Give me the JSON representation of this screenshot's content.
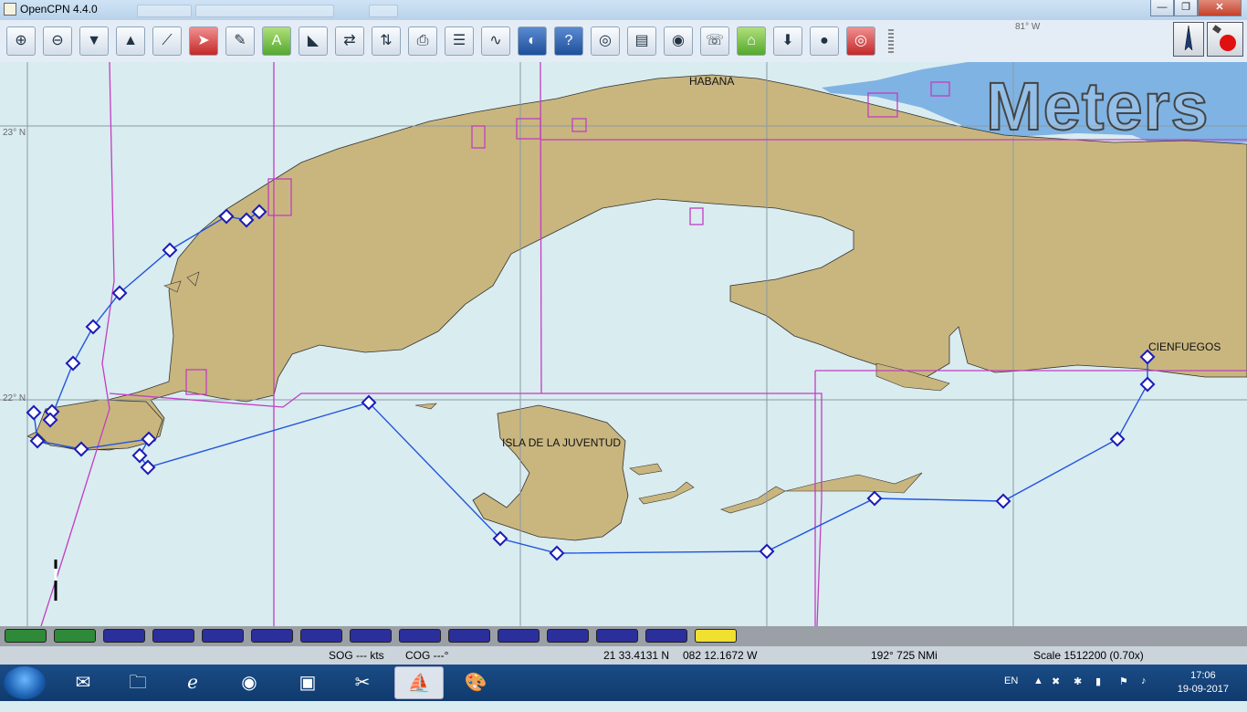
{
  "window": {
    "title": "OpenCPN 4.4.0",
    "minimize": "—",
    "maximize": "❐",
    "close": "✕"
  },
  "toolbar": {
    "tools": [
      {
        "name": "zoom-in-button",
        "glyph": "⊕",
        "style": ""
      },
      {
        "name": "zoom-out-button",
        "glyph": "⊖",
        "style": ""
      },
      {
        "name": "scale-in-button",
        "glyph": "▼",
        "style": ""
      },
      {
        "name": "scale-out-button",
        "glyph": "▲",
        "style": ""
      },
      {
        "name": "route-button",
        "glyph": "⟋",
        "style": ""
      },
      {
        "name": "auto-follow-button",
        "glyph": "➤",
        "style": "red"
      },
      {
        "name": "options-button",
        "glyph": "✎",
        "style": ""
      },
      {
        "name": "text-button",
        "glyph": "A",
        "style": "green"
      },
      {
        "name": "current-tide-button",
        "glyph": "◣",
        "style": ""
      },
      {
        "name": "tide-button",
        "glyph": "⇄",
        "style": ""
      },
      {
        "name": "current-button",
        "glyph": "⇅",
        "style": ""
      },
      {
        "name": "print-button",
        "glyph": "⎙",
        "style": ""
      },
      {
        "name": "route-manager-button",
        "glyph": "☰",
        "style": ""
      },
      {
        "name": "track-button",
        "glyph": "∿",
        "style": ""
      },
      {
        "name": "color-scheme-button",
        "glyph": "◐",
        "style": "navy"
      },
      {
        "name": "help-button",
        "glyph": "?",
        "style": "navy"
      },
      {
        "name": "dashboard-button",
        "glyph": "◎",
        "style": ""
      },
      {
        "name": "grib-button",
        "glyph": "▤",
        "style": ""
      },
      {
        "name": "google-earth-button",
        "glyph": "◉",
        "style": ""
      },
      {
        "name": "chart-download-button",
        "glyph": "☏",
        "style": ""
      },
      {
        "name": "lighthouse-button",
        "glyph": "⌂",
        "style": "green"
      },
      {
        "name": "download-button",
        "glyph": "⬇",
        "style": ""
      },
      {
        "name": "globe-button",
        "glyph": "●",
        "style": ""
      },
      {
        "name": "mob-button",
        "glyph": "◎",
        "style": "red"
      }
    ]
  },
  "map": {
    "units_watermark": "Meters",
    "labels": {
      "habana": "HABANA",
      "isla": "ISLA DE LA JUVENTUD",
      "cienfuegos": "CIENFUEGOS"
    },
    "grid": {
      "lat_23": "23° N",
      "lat_22": "22° N",
      "lon_81": "81° W"
    },
    "colors": {
      "water": "#d9ecf0",
      "land": "#c9b67f",
      "shallow": "#7fb3e3",
      "route": "#2255dd",
      "chart_border": "#c23ec2"
    }
  },
  "piano": {
    "keys": [
      "green",
      "green",
      "navy",
      "navy",
      "navy",
      "navy",
      "navy",
      "navy",
      "navy",
      "navy",
      "navy",
      "navy",
      "navy",
      "navy",
      "yellow"
    ],
    "colors": {
      "green": "#2e8a38",
      "navy": "#2b2f9c",
      "yellow": "#f0e030"
    }
  },
  "status": {
    "sog": "SOG --- kts",
    "cog": "COG ---°",
    "lat": "21 33.4131 N",
    "lon": "082 12.1672 W",
    "bearing": "192°  725 NMi",
    "scale": "Scale 1512200 (0.70x)"
  },
  "taskbar": {
    "items": [
      "explorer",
      "ie",
      "chrome",
      "media",
      "tool",
      "opencpn",
      "paint"
    ],
    "language": "EN",
    "time": "17:06",
    "date": "19-09-2017"
  }
}
